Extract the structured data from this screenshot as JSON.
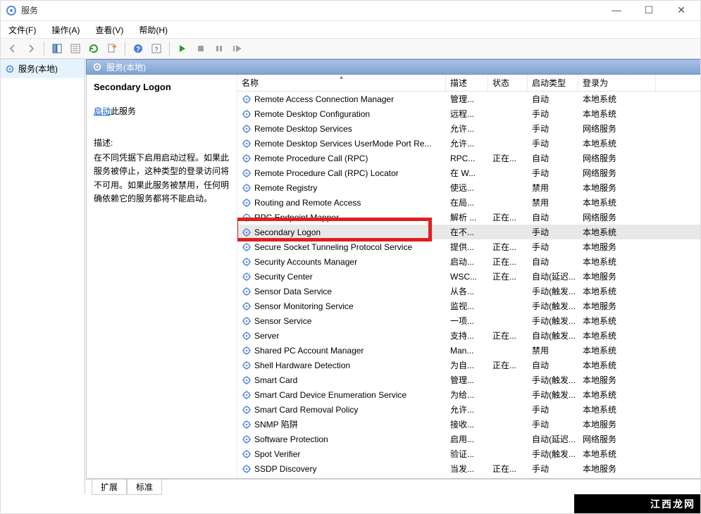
{
  "window": {
    "title": "服务",
    "min": "—",
    "max": "☐",
    "close": "✕"
  },
  "menu": {
    "file": "文件(F)",
    "action": "操作(A)",
    "view": "查看(V)",
    "help": "帮助(H)"
  },
  "tree": {
    "root": "服务(本地)"
  },
  "details_header": "服务(本地)",
  "info": {
    "service_name": "Secondary Logon",
    "start_link": "启动",
    "start_suffix": "此服务",
    "desc_label": "描述:",
    "desc_text": "在不同凭据下启用启动过程。如果此服务被停止，这种类型的登录访问将不可用。如果此服务被禁用，任何明确依赖它的服务都将不能启动。"
  },
  "columns": {
    "name": "名称",
    "desc": "描述",
    "state": "状态",
    "start": "启动类型",
    "logon": "登录为"
  },
  "tabs": {
    "extended": "扩展",
    "standard": "标准"
  },
  "watermark": "江西龙网",
  "highlight_row_index": 9,
  "rows": [
    {
      "name": "Remote Access Connection Manager",
      "desc": "管理...",
      "state": "",
      "start": "自动",
      "logon": "本地系统"
    },
    {
      "name": "Remote Desktop Configuration",
      "desc": "远程...",
      "state": "",
      "start": "手动",
      "logon": "本地系统"
    },
    {
      "name": "Remote Desktop Services",
      "desc": "允许...",
      "state": "",
      "start": "手动",
      "logon": "网络服务"
    },
    {
      "name": "Remote Desktop Services UserMode Port Re...",
      "desc": "允许...",
      "state": "",
      "start": "手动",
      "logon": "本地系统"
    },
    {
      "name": "Remote Procedure Call (RPC)",
      "desc": "RPC...",
      "state": "正在...",
      "start": "自动",
      "logon": "网络服务"
    },
    {
      "name": "Remote Procedure Call (RPC) Locator",
      "desc": "在 W...",
      "state": "",
      "start": "手动",
      "logon": "网络服务"
    },
    {
      "name": "Remote Registry",
      "desc": "使远...",
      "state": "",
      "start": "禁用",
      "logon": "本地服务"
    },
    {
      "name": "Routing and Remote Access",
      "desc": "在局...",
      "state": "",
      "start": "禁用",
      "logon": "本地系统"
    },
    {
      "name": "RPC Endpoint Mapper",
      "desc": "解析 ...",
      "state": "正在...",
      "start": "自动",
      "logon": "网络服务"
    },
    {
      "name": "Secondary Logon",
      "desc": "在不...",
      "state": "",
      "start": "手动",
      "logon": "本地系统"
    },
    {
      "name": "Secure Socket Tunneling Protocol Service",
      "desc": "提供...",
      "state": "正在...",
      "start": "手动",
      "logon": "本地服务"
    },
    {
      "name": "Security Accounts Manager",
      "desc": "启动...",
      "state": "正在...",
      "start": "自动",
      "logon": "本地系统"
    },
    {
      "name": "Security Center",
      "desc": "WSC...",
      "state": "正在...",
      "start": "自动(延迟...",
      "logon": "本地服务"
    },
    {
      "name": "Sensor Data Service",
      "desc": "从各...",
      "state": "",
      "start": "手动(触发...",
      "logon": "本地系统"
    },
    {
      "name": "Sensor Monitoring Service",
      "desc": "监视...",
      "state": "",
      "start": "手动(触发...",
      "logon": "本地服务"
    },
    {
      "name": "Sensor Service",
      "desc": "一项...",
      "state": "",
      "start": "手动(触发...",
      "logon": "本地系统"
    },
    {
      "name": "Server",
      "desc": "支持...",
      "state": "正在...",
      "start": "自动(触发...",
      "logon": "本地系统"
    },
    {
      "name": "Shared PC Account Manager",
      "desc": "Man...",
      "state": "",
      "start": "禁用",
      "logon": "本地系统"
    },
    {
      "name": "Shell Hardware Detection",
      "desc": "为自...",
      "state": "正在...",
      "start": "自动",
      "logon": "本地系统"
    },
    {
      "name": "Smart Card",
      "desc": "管理...",
      "state": "",
      "start": "手动(触发...",
      "logon": "本地服务"
    },
    {
      "name": "Smart Card Device Enumeration Service",
      "desc": "为给...",
      "state": "",
      "start": "手动(触发...",
      "logon": "本地系统"
    },
    {
      "name": "Smart Card Removal Policy",
      "desc": "允许...",
      "state": "",
      "start": "手动",
      "logon": "本地系统"
    },
    {
      "name": "SNMP 陷阱",
      "desc": "接收...",
      "state": "",
      "start": "手动",
      "logon": "本地服务"
    },
    {
      "name": "Software Protection",
      "desc": "启用...",
      "state": "",
      "start": "自动(延迟...",
      "logon": "网络服务"
    },
    {
      "name": "Spot Verifier",
      "desc": "验证...",
      "state": "",
      "start": "手动(触发...",
      "logon": "本地系统"
    },
    {
      "name": "SSDP Discovery",
      "desc": "当发...",
      "state": "正在...",
      "start": "手动",
      "logon": "本地服务"
    }
  ]
}
